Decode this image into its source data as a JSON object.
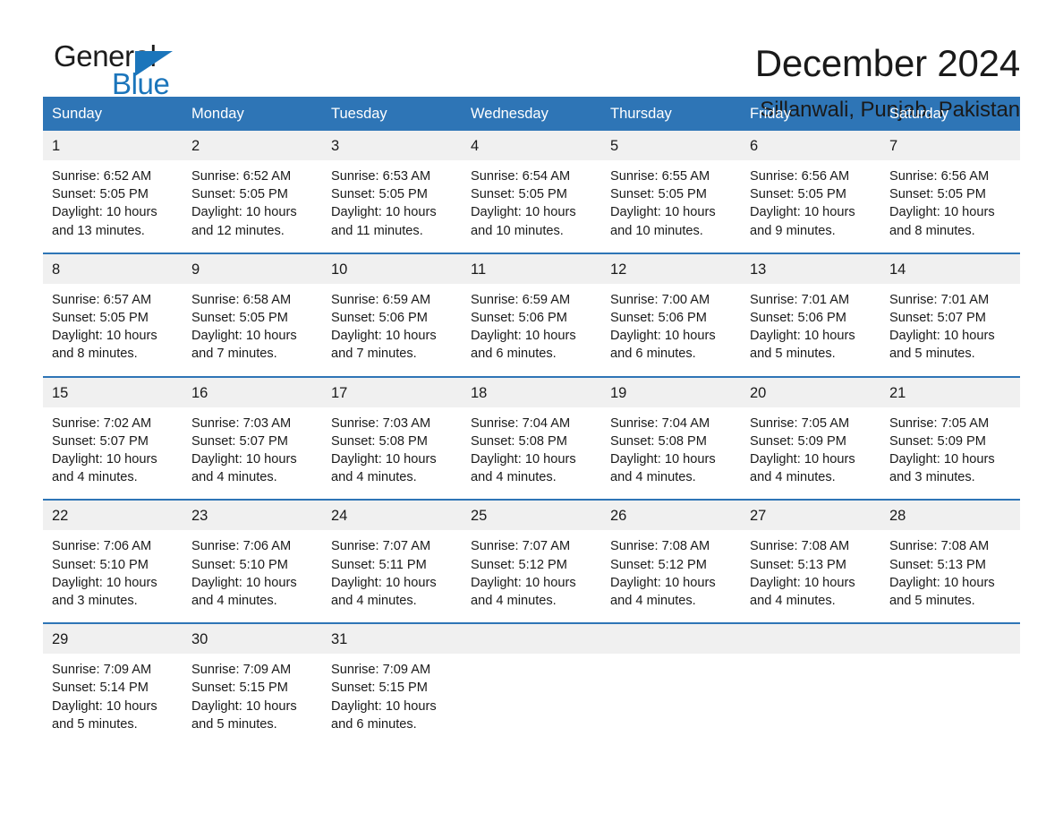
{
  "brand": {
    "name_part1": "General",
    "name_part2": "Blue",
    "accent_color": "#1b75bb"
  },
  "header": {
    "month_title": "December 2024",
    "location": "Sillanwali, Punjab, Pakistan"
  },
  "calendar": {
    "header_bg": "#2e75b6",
    "weekday_headers": [
      "Sunday",
      "Monday",
      "Tuesday",
      "Wednesday",
      "Thursday",
      "Friday",
      "Saturday"
    ],
    "weeks": [
      [
        {
          "day": "1",
          "sunrise": "Sunrise: 6:52 AM",
          "sunset": "Sunset: 5:05 PM",
          "daylight_line1": "Daylight: 10 hours",
          "daylight_line2": "and 13 minutes."
        },
        {
          "day": "2",
          "sunrise": "Sunrise: 6:52 AM",
          "sunset": "Sunset: 5:05 PM",
          "daylight_line1": "Daylight: 10 hours",
          "daylight_line2": "and 12 minutes."
        },
        {
          "day": "3",
          "sunrise": "Sunrise: 6:53 AM",
          "sunset": "Sunset: 5:05 PM",
          "daylight_line1": "Daylight: 10 hours",
          "daylight_line2": "and 11 minutes."
        },
        {
          "day": "4",
          "sunrise": "Sunrise: 6:54 AM",
          "sunset": "Sunset: 5:05 PM",
          "daylight_line1": "Daylight: 10 hours",
          "daylight_line2": "and 10 minutes."
        },
        {
          "day": "5",
          "sunrise": "Sunrise: 6:55 AM",
          "sunset": "Sunset: 5:05 PM",
          "daylight_line1": "Daylight: 10 hours",
          "daylight_line2": "and 10 minutes."
        },
        {
          "day": "6",
          "sunrise": "Sunrise: 6:56 AM",
          "sunset": "Sunset: 5:05 PM",
          "daylight_line1": "Daylight: 10 hours",
          "daylight_line2": "and 9 minutes."
        },
        {
          "day": "7",
          "sunrise": "Sunrise: 6:56 AM",
          "sunset": "Sunset: 5:05 PM",
          "daylight_line1": "Daylight: 10 hours",
          "daylight_line2": "and 8 minutes."
        }
      ],
      [
        {
          "day": "8",
          "sunrise": "Sunrise: 6:57 AM",
          "sunset": "Sunset: 5:05 PM",
          "daylight_line1": "Daylight: 10 hours",
          "daylight_line2": "and 8 minutes."
        },
        {
          "day": "9",
          "sunrise": "Sunrise: 6:58 AM",
          "sunset": "Sunset: 5:05 PM",
          "daylight_line1": "Daylight: 10 hours",
          "daylight_line2": "and 7 minutes."
        },
        {
          "day": "10",
          "sunrise": "Sunrise: 6:59 AM",
          "sunset": "Sunset: 5:06 PM",
          "daylight_line1": "Daylight: 10 hours",
          "daylight_line2": "and 7 minutes."
        },
        {
          "day": "11",
          "sunrise": "Sunrise: 6:59 AM",
          "sunset": "Sunset: 5:06 PM",
          "daylight_line1": "Daylight: 10 hours",
          "daylight_line2": "and 6 minutes."
        },
        {
          "day": "12",
          "sunrise": "Sunrise: 7:00 AM",
          "sunset": "Sunset: 5:06 PM",
          "daylight_line1": "Daylight: 10 hours",
          "daylight_line2": "and 6 minutes."
        },
        {
          "day": "13",
          "sunrise": "Sunrise: 7:01 AM",
          "sunset": "Sunset: 5:06 PM",
          "daylight_line1": "Daylight: 10 hours",
          "daylight_line2": "and 5 minutes."
        },
        {
          "day": "14",
          "sunrise": "Sunrise: 7:01 AM",
          "sunset": "Sunset: 5:07 PM",
          "daylight_line1": "Daylight: 10 hours",
          "daylight_line2": "and 5 minutes."
        }
      ],
      [
        {
          "day": "15",
          "sunrise": "Sunrise: 7:02 AM",
          "sunset": "Sunset: 5:07 PM",
          "daylight_line1": "Daylight: 10 hours",
          "daylight_line2": "and 4 minutes."
        },
        {
          "day": "16",
          "sunrise": "Sunrise: 7:03 AM",
          "sunset": "Sunset: 5:07 PM",
          "daylight_line1": "Daylight: 10 hours",
          "daylight_line2": "and 4 minutes."
        },
        {
          "day": "17",
          "sunrise": "Sunrise: 7:03 AM",
          "sunset": "Sunset: 5:08 PM",
          "daylight_line1": "Daylight: 10 hours",
          "daylight_line2": "and 4 minutes."
        },
        {
          "day": "18",
          "sunrise": "Sunrise: 7:04 AM",
          "sunset": "Sunset: 5:08 PM",
          "daylight_line1": "Daylight: 10 hours",
          "daylight_line2": "and 4 minutes."
        },
        {
          "day": "19",
          "sunrise": "Sunrise: 7:04 AM",
          "sunset": "Sunset: 5:08 PM",
          "daylight_line1": "Daylight: 10 hours",
          "daylight_line2": "and 4 minutes."
        },
        {
          "day": "20",
          "sunrise": "Sunrise: 7:05 AM",
          "sunset": "Sunset: 5:09 PM",
          "daylight_line1": "Daylight: 10 hours",
          "daylight_line2": "and 4 minutes."
        },
        {
          "day": "21",
          "sunrise": "Sunrise: 7:05 AM",
          "sunset": "Sunset: 5:09 PM",
          "daylight_line1": "Daylight: 10 hours",
          "daylight_line2": "and 3 minutes."
        }
      ],
      [
        {
          "day": "22",
          "sunrise": "Sunrise: 7:06 AM",
          "sunset": "Sunset: 5:10 PM",
          "daylight_line1": "Daylight: 10 hours",
          "daylight_line2": "and 3 minutes."
        },
        {
          "day": "23",
          "sunrise": "Sunrise: 7:06 AM",
          "sunset": "Sunset: 5:10 PM",
          "daylight_line1": "Daylight: 10 hours",
          "daylight_line2": "and 4 minutes."
        },
        {
          "day": "24",
          "sunrise": "Sunrise: 7:07 AM",
          "sunset": "Sunset: 5:11 PM",
          "daylight_line1": "Daylight: 10 hours",
          "daylight_line2": "and 4 minutes."
        },
        {
          "day": "25",
          "sunrise": "Sunrise: 7:07 AM",
          "sunset": "Sunset: 5:12 PM",
          "daylight_line1": "Daylight: 10 hours",
          "daylight_line2": "and 4 minutes."
        },
        {
          "day": "26",
          "sunrise": "Sunrise: 7:08 AM",
          "sunset": "Sunset: 5:12 PM",
          "daylight_line1": "Daylight: 10 hours",
          "daylight_line2": "and 4 minutes."
        },
        {
          "day": "27",
          "sunrise": "Sunrise: 7:08 AM",
          "sunset": "Sunset: 5:13 PM",
          "daylight_line1": "Daylight: 10 hours",
          "daylight_line2": "and 4 minutes."
        },
        {
          "day": "28",
          "sunrise": "Sunrise: 7:08 AM",
          "sunset": "Sunset: 5:13 PM",
          "daylight_line1": "Daylight: 10 hours",
          "daylight_line2": "and 5 minutes."
        }
      ],
      [
        {
          "day": "29",
          "sunrise": "Sunrise: 7:09 AM",
          "sunset": "Sunset: 5:14 PM",
          "daylight_line1": "Daylight: 10 hours",
          "daylight_line2": "and 5 minutes."
        },
        {
          "day": "30",
          "sunrise": "Sunrise: 7:09 AM",
          "sunset": "Sunset: 5:15 PM",
          "daylight_line1": "Daylight: 10 hours",
          "daylight_line2": "and 5 minutes."
        },
        {
          "day": "31",
          "sunrise": "Sunrise: 7:09 AM",
          "sunset": "Sunset: 5:15 PM",
          "daylight_line1": "Daylight: 10 hours",
          "daylight_line2": "and 6 minutes."
        },
        {
          "day": "",
          "sunrise": "",
          "sunset": "",
          "daylight_line1": "",
          "daylight_line2": ""
        },
        {
          "day": "",
          "sunrise": "",
          "sunset": "",
          "daylight_line1": "",
          "daylight_line2": ""
        },
        {
          "day": "",
          "sunrise": "",
          "sunset": "",
          "daylight_line1": "",
          "daylight_line2": ""
        },
        {
          "day": "",
          "sunrise": "",
          "sunset": "",
          "daylight_line1": "",
          "daylight_line2": ""
        }
      ]
    ]
  }
}
